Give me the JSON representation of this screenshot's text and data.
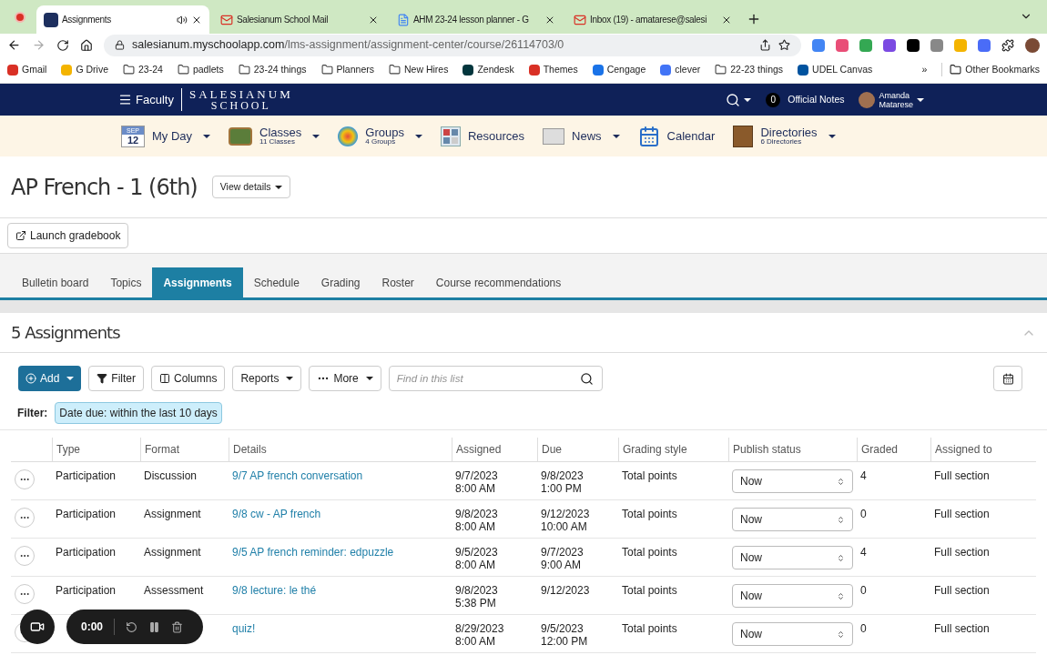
{
  "browser": {
    "tabs": [
      {
        "title": "Assignments",
        "selected": true,
        "kind": "s"
      },
      {
        "title": "Salesianum School Mail",
        "selected": false,
        "kind": "mail"
      },
      {
        "title": "AHM 23-24 lesson planner - G",
        "selected": false,
        "kind": "doc"
      },
      {
        "title": "Inbox (19) - amatarese@salesi",
        "selected": false,
        "kind": "mail"
      }
    ],
    "url_host": "salesianum.myschoolapp.com",
    "url_path": "/lms-assignment/assignment-center/course/26114703/0",
    "bookmarks": [
      {
        "label": "Gmail",
        "kind": "mail"
      },
      {
        "label": "G Drive",
        "kind": "drive"
      },
      {
        "label": "23-24",
        "kind": "folder"
      },
      {
        "label": "padlets",
        "kind": "folder"
      },
      {
        "label": "23-24 things",
        "kind": "folder"
      },
      {
        "label": "Planners",
        "kind": "folder"
      },
      {
        "label": "New Hires",
        "kind": "folder"
      },
      {
        "label": "Zendesk",
        "kind": "zen"
      },
      {
        "label": "Themes",
        "kind": "themes"
      },
      {
        "label": "Cengage",
        "kind": "cengage"
      },
      {
        "label": "clever",
        "kind": "clever"
      },
      {
        "label": "22-23 things",
        "kind": "folder"
      },
      {
        "label": "UDEL Canvas",
        "kind": "udel"
      }
    ],
    "overflow": "»",
    "other_bookmarks": "Other Bookmarks"
  },
  "header": {
    "menu": "Faculty",
    "logo_top": "SALESIANUM",
    "logo_bottom": "SCHOOL",
    "notes_count": "0",
    "notes_label": "Official Notes",
    "user_first": "Amanda",
    "user_last": "Matarese"
  },
  "nav": [
    {
      "label": "My Day",
      "kind": "day",
      "month": "SEP",
      "day": "12",
      "caret": true
    },
    {
      "label": "Classes",
      "sub": "11 Classes",
      "kind": "classes",
      "caret": true
    },
    {
      "label": "Groups",
      "sub": "4 Groups",
      "kind": "groups",
      "caret": true
    },
    {
      "label": "Resources",
      "kind": "resources",
      "caret": false
    },
    {
      "label": "News",
      "kind": "news",
      "caret": true
    },
    {
      "label": "Calendar",
      "kind": "calendar",
      "caret": false
    },
    {
      "label": "Directories",
      "sub": "6 Directories",
      "kind": "directories",
      "caret": true
    }
  ],
  "page": {
    "title": "AP French - 1 (6th)",
    "details_button": "View details",
    "gradebook_button": "Launch gradebook"
  },
  "tabs": [
    {
      "label": "Bulletin board",
      "selected": false
    },
    {
      "label": "Topics",
      "selected": false
    },
    {
      "label": "Assignments",
      "selected": true
    },
    {
      "label": "Schedule",
      "selected": false
    },
    {
      "label": "Grading",
      "selected": false
    },
    {
      "label": "Roster",
      "selected": false
    },
    {
      "label": "Course recommendations",
      "selected": false
    }
  ],
  "section": {
    "title": "5 Assignments",
    "expanded": true
  },
  "toolbar": {
    "add": "Add",
    "filter": "Filter",
    "columns": "Columns",
    "reports": "Reports",
    "more": "More",
    "search_placeholder": "Find in this list"
  },
  "filter": {
    "label": "Filter:",
    "chip": "Date due: within the last 10 days"
  },
  "table": {
    "columns": [
      "Type",
      "Format",
      "Details",
      "Assigned",
      "Due",
      "Grading style",
      "Publish status",
      "Graded",
      "Assigned to"
    ],
    "rows": [
      {
        "type": "Participation",
        "format": "Discussion",
        "details": "9/7 AP french conversation",
        "assigned": [
          "9/7/2023",
          "8:00 AM"
        ],
        "due": [
          "9/8/2023",
          "1:00 PM"
        ],
        "grading": "Total points",
        "publish": "Now",
        "graded": "4",
        "assigned_to": "Full section"
      },
      {
        "type": "Participation",
        "format": "Assignment",
        "details": "9/8 cw - AP french",
        "assigned": [
          "9/8/2023",
          "8:00 AM"
        ],
        "due": [
          "9/12/2023",
          "10:00 AM"
        ],
        "grading": "Total points",
        "publish": "Now",
        "graded": "0",
        "assigned_to": "Full section"
      },
      {
        "type": "Participation",
        "format": "Assignment",
        "details": "9/5 AP french reminder: edpuzzle",
        "assigned": [
          "9/5/2023",
          "8:00 AM"
        ],
        "due": [
          "9/7/2023",
          "9:00 AM"
        ],
        "grading": "Total points",
        "publish": "Now",
        "graded": "4",
        "assigned_to": "Full section"
      },
      {
        "type": "Participation",
        "format": "Assessment",
        "details": "9/8 lecture: le thé",
        "assigned": [
          "9/8/2023",
          "5:38 PM"
        ],
        "due": [
          "9/12/2023"
        ],
        "grading": "Total points",
        "publish": "Now",
        "graded": "0",
        "assigned_to": "Full section"
      },
      {
        "details": "quiz!",
        "assigned": [
          "8/29/2023",
          "8:00 AM"
        ],
        "due": [
          "9/5/2023",
          "12:00 PM"
        ],
        "grading": "Total points",
        "publish": "Now",
        "graded": "0",
        "assigned_to": "Full section"
      }
    ]
  },
  "recorder": {
    "time": "0:00"
  }
}
